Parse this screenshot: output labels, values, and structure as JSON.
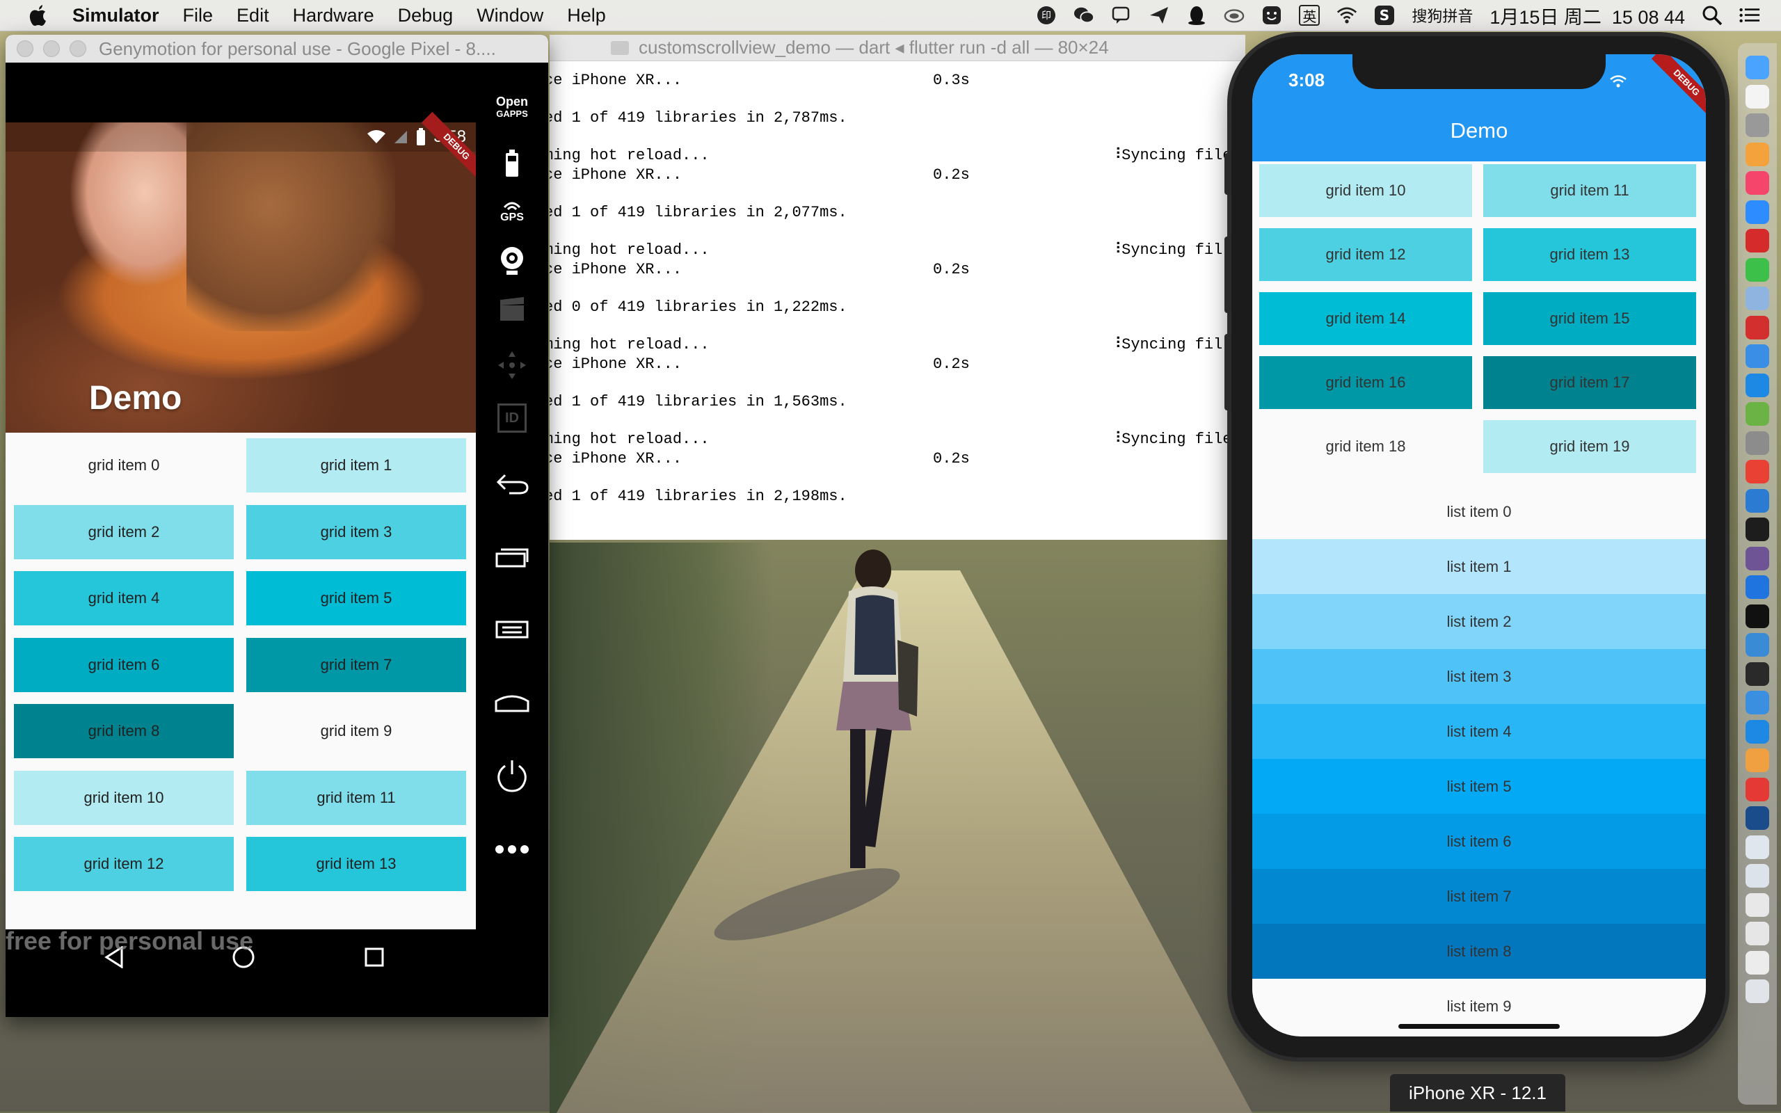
{
  "menubar": {
    "app_name": "Simulator",
    "menus": [
      "File",
      "Edit",
      "Hardware",
      "Debug",
      "Window",
      "Help"
    ],
    "input_method": "搜狗拼音",
    "lang_indicator": "英",
    "datetime": "1月15日 周二  15 08 44"
  },
  "genymotion": {
    "window_title": "Genymotion for personal use - Google Pixel - 8....",
    "android": {
      "status_time": "3:58",
      "debug_badge": "DEBUG",
      "app_title": "Demo",
      "grid_items": [
        {
          "label": "grid item 0",
          "color": "#fafafa"
        },
        {
          "label": "grid item 1",
          "color": "#b2ebf2"
        },
        {
          "label": "grid item 2",
          "color": "#80deea"
        },
        {
          "label": "grid item 3",
          "color": "#4dd0e1"
        },
        {
          "label": "grid item 4",
          "color": "#26c6da"
        },
        {
          "label": "grid item 5",
          "color": "#00bcd4"
        },
        {
          "label": "grid item 6",
          "color": "#00acc1"
        },
        {
          "label": "grid item 7",
          "color": "#0097a7"
        },
        {
          "label": "grid item 8",
          "color": "#00838f"
        },
        {
          "label": "grid item 9",
          "color": "#fafafa"
        },
        {
          "label": "grid item 10",
          "color": "#b2ebf2"
        },
        {
          "label": "grid item 11",
          "color": "#80deea"
        },
        {
          "label": "grid item 12",
          "color": "#4dd0e1"
        },
        {
          "label": "grid item 13",
          "color": "#26c6da"
        }
      ],
      "watermark": "free for personal use"
    },
    "sidebar": {
      "opengapps_line1": "Open",
      "opengapps_line2": "GAPPS",
      "gps_label": "GPS",
      "id_label": "ID"
    }
  },
  "terminal": {
    "window_title": "customscrollview_demo — dart ◂ flutter run -d all — 80×24",
    "lines": [
      {
        "left": "ce iPhone XR...",
        "mid": "0.3s",
        "right": ""
      },
      {
        "left": "ed 1 of 419 libraries in 2,787ms.",
        "mid": "",
        "right": ""
      },
      {
        "left": "ming hot reload...",
        "mid": "",
        "right": "⠸Syncing files"
      },
      {
        "left": "ce iPhone XR...",
        "mid": "0.2s",
        "right": ""
      },
      {
        "left": "ed 1 of 419 libraries in 2,077ms.",
        "mid": "",
        "right": ""
      },
      {
        "left": "ming hot reload...",
        "mid": "",
        "right": "⠸Syncing fil"
      },
      {
        "left": "ce iPhone XR...",
        "mid": "0.2s",
        "right": ""
      },
      {
        "left": "ed 0 of 419 libraries in 1,222ms.",
        "mid": "",
        "right": ""
      },
      {
        "left": "ming hot reload...",
        "mid": "",
        "right": "⠸Syncing fil"
      },
      {
        "left": "ce iPhone XR...",
        "mid": "0.2s",
        "right": ""
      },
      {
        "left": "ed 1 of 419 libraries in 1,563ms.",
        "mid": "",
        "right": ""
      },
      {
        "left": "ming hot reload...",
        "mid": "",
        "right": "⠸Syncing file"
      },
      {
        "left": "ce iPhone XR...",
        "mid": "0.2s",
        "right": ""
      },
      {
        "left": "ed 1 of 419 libraries in 2,198ms.",
        "mid": "",
        "right": ""
      }
    ]
  },
  "iphone": {
    "status_time": "3:08",
    "debug_badge": "DEBUG",
    "app_title": "Demo",
    "grid_items": [
      {
        "label": "grid item 10",
        "color": "#b2ebf2"
      },
      {
        "label": "grid item 11",
        "color": "#80deea"
      },
      {
        "label": "grid item 12",
        "color": "#4dd0e1"
      },
      {
        "label": "grid item 13",
        "color": "#26c6da"
      },
      {
        "label": "grid item 14",
        "color": "#00bcd4"
      },
      {
        "label": "grid item 15",
        "color": "#00acc1"
      },
      {
        "label": "grid item 16",
        "color": "#0097a7"
      },
      {
        "label": "grid item 17",
        "color": "#00838f"
      },
      {
        "label": "grid item 18",
        "color": "#fafafa"
      },
      {
        "label": "grid item 19",
        "color": "#b2ebf2"
      }
    ],
    "list_items": [
      {
        "label": "list item 0",
        "color": "#fafafa"
      },
      {
        "label": "list item 1",
        "color": "#b3e5fc"
      },
      {
        "label": "list item 2",
        "color": "#81d4fa"
      },
      {
        "label": "list item 3",
        "color": "#4fc3f7"
      },
      {
        "label": "list item 4",
        "color": "#29b6f6"
      },
      {
        "label": "list item 5",
        "color": "#03a9f4"
      },
      {
        "label": "list item 6",
        "color": "#039be5"
      },
      {
        "label": "list item 7",
        "color": "#0288d1"
      },
      {
        "label": "list item 8",
        "color": "#0277bd"
      },
      {
        "label": "list item 9",
        "color": "#fafafa"
      }
    ],
    "device_label": "iPhone XR - 12.1"
  },
  "colors": {
    "appbar_blue": "#2196f3",
    "debug_red": "#a51c1c"
  }
}
